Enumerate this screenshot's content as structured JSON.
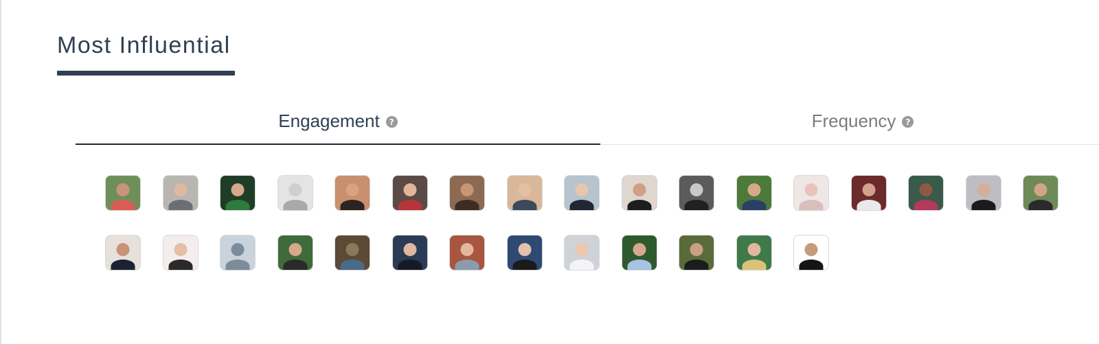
{
  "section": {
    "title": "Most Influential"
  },
  "tabs": [
    {
      "label": "Engagement",
      "active": true
    },
    {
      "label": "Frequency",
      "active": false
    }
  ],
  "help_icon_glyph": "?",
  "avatars": [
    {
      "bg": "#6f8f5a",
      "skin": "#c8957a",
      "cloth": "#d95c55"
    },
    {
      "bg": "#b9b6b2",
      "skin": "#e0b7a0",
      "cloth": "#6b6e73"
    },
    {
      "bg": "#1f3d26",
      "skin": "#d7a88a",
      "cloth": "#2f7a3d"
    },
    {
      "bg": "#e4e4e4",
      "skin": "#cfcfcf",
      "cloth": "#a9a9a9"
    },
    {
      "bg": "#c98f6f",
      "skin": "#d9a37f",
      "cloth": "#2b2422"
    },
    {
      "bg": "#5b4a45",
      "skin": "#e0b598",
      "cloth": "#b4363a"
    },
    {
      "bg": "#8c6a52",
      "skin": "#c99574",
      "cloth": "#3b2c24"
    },
    {
      "bg": "#d9b79a",
      "skin": "#e5bfa1",
      "cloth": "#3d4a5c"
    },
    {
      "bg": "#b7c3cf",
      "skin": "#e6c6ad",
      "cloth": "#1e2733"
    },
    {
      "bg": "#ded6cf",
      "skin": "#cfa085",
      "cloth": "#1d1d1d"
    },
    {
      "bg": "#5b5b5b",
      "skin": "#c9c9c9",
      "cloth": "#202020"
    },
    {
      "bg": "#4d7a3a",
      "skin": "#d7a98c",
      "cloth": "#2a3f66"
    },
    {
      "bg": "#efe7e5",
      "skin": "#e8c3bc",
      "cloth": "#d9bfbb"
    },
    {
      "bg": "#6c2a2a",
      "skin": "#d1a28b",
      "cloth": "#e9e9e9"
    },
    {
      "bg": "#3a5a4a",
      "skin": "#8c5a43",
      "cloth": "#b23a5a"
    },
    {
      "bg": "#bdbdc2",
      "skin": "#d6ad98",
      "cloth": "#1b1b1b"
    },
    {
      "bg": "#6e8a58",
      "skin": "#d3a385",
      "cloth": "#2a2a2a"
    },
    {
      "bg": "#e7e1dc",
      "skin": "#c89377",
      "cloth": "#1b2333"
    },
    {
      "bg": "#f3eeeb",
      "skin": "#e6bda5",
      "cloth": "#2a2a2a"
    },
    {
      "bg": "#c9d3dc",
      "skin": "#7d8c9a",
      "cloth": "#7d8c9a",
      "placeholder": true
    },
    {
      "bg": "#3f6b3a",
      "skin": "#d9a78b",
      "cloth": "#2a2a2a"
    },
    {
      "bg": "#5c4a36",
      "skin": "#8a7a5a",
      "cloth": "#4a6a8a"
    },
    {
      "bg": "#2a3b55",
      "skin": "#e0b79e",
      "cloth": "#151b26"
    },
    {
      "bg": "#a85640",
      "skin": "#e3b79c",
      "cloth": "#8b9bab"
    },
    {
      "bg": "#2e4a73",
      "skin": "#e4c1aa",
      "cloth": "#1b1b1b"
    },
    {
      "bg": "#cfd2d6",
      "skin": "#ecc7ae",
      "cloth": "#f4f4f6"
    },
    {
      "bg": "#2d5a2d",
      "skin": "#d7a98c",
      "cloth": "#a9c1e2"
    },
    {
      "bg": "#5a6b3a",
      "skin": "#caa084",
      "cloth": "#1c1c1c"
    },
    {
      "bg": "#3f7a4a",
      "skin": "#e2b89d",
      "cloth": "#d9c27a"
    },
    {
      "bg": "#ffffff",
      "skin": "#c59b7a",
      "cloth": "#151515"
    }
  ]
}
